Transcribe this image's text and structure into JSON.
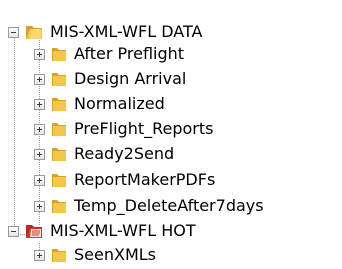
{
  "tree": {
    "root_data": {
      "label": "MIS-XML-WFL DATA",
      "state": "expanded",
      "icon": "folder-open-icon",
      "children": [
        {
          "label": "After Preflight",
          "state": "collapsed",
          "icon": "folder-icon"
        },
        {
          "label": "Design Arrival",
          "state": "collapsed",
          "icon": "folder-icon"
        },
        {
          "label": "Normalized",
          "state": "collapsed",
          "icon": "folder-icon"
        },
        {
          "label": "PreFlight_Reports",
          "state": "collapsed",
          "icon": "folder-icon"
        },
        {
          "label": "Ready2Send",
          "state": "collapsed",
          "icon": "folder-icon"
        },
        {
          "label": "ReportMakerPDFs",
          "state": "collapsed",
          "icon": "folder-icon"
        },
        {
          "label": "Temp_DeleteAfter7days",
          "state": "collapsed",
          "icon": "folder-icon"
        }
      ]
    },
    "root_hot": {
      "label": "MIS-XML-WFL HOT",
      "state": "expanded",
      "icon": "red-folder-open-icon",
      "children": [
        {
          "label": "SeenXMLs",
          "state": "collapsed",
          "icon": "folder-icon"
        }
      ]
    }
  },
  "colors": {
    "folder_yellow": "#f3c74b",
    "folder_dark": "#d8a12a",
    "folder_red": "#d9342b",
    "connector": "#a0a0a0"
  }
}
